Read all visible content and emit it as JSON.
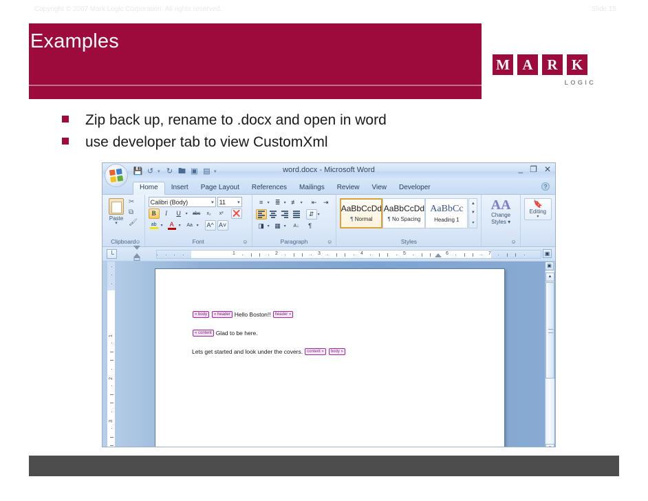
{
  "slide": {
    "title": "Examples",
    "bullets": [
      "Zip back up, rename to .docx and open in word",
      "use developer tab to view CustomXml"
    ],
    "footer": {
      "copyright": "Copyright © 2007 Mark Logic Corporation.  All rights reserved.",
      "slide_number": "Slide 15"
    },
    "logo": {
      "letters": [
        "M",
        "A",
        "R",
        "K"
      ],
      "subtitle": "LOGIC",
      "brand_color": "#9d0b3d"
    },
    "colors": {
      "banner": "#9d0b3d",
      "bullet_marker": "#9d0b3d",
      "footer_bar": "#4d4d4d",
      "body_text": "#1a1a1a"
    }
  },
  "word": {
    "titlebar": {
      "document_title": "word.docx - Microsoft Word",
      "orb": "office-orb",
      "qat": [
        {
          "name": "save-icon",
          "glyph": "■"
        },
        {
          "name": "undo-icon",
          "glyph": "↶"
        },
        {
          "name": "undo-dropdown-caret",
          "glyph": "▾"
        },
        {
          "name": "redo-icon",
          "glyph": "↷"
        },
        {
          "name": "open-icon",
          "glyph": "▱"
        },
        {
          "name": "print-preview-icon",
          "glyph": "▣"
        },
        {
          "name": "quick-print-icon",
          "glyph": "▤"
        },
        {
          "name": "customize-qat-caret",
          "glyph": "▾"
        }
      ],
      "window_controls": [
        {
          "name": "minimize-button",
          "glyph": "–"
        },
        {
          "name": "maximize-button",
          "glyph": "❐"
        },
        {
          "name": "close-button",
          "glyph": "✕"
        }
      ]
    },
    "tabs": [
      {
        "label": "Home",
        "active": true
      },
      {
        "label": "Insert",
        "active": false
      },
      {
        "label": "Page Layout",
        "active": false
      },
      {
        "label": "References",
        "active": false
      },
      {
        "label": "Mailings",
        "active": false
      },
      {
        "label": "Review",
        "active": false
      },
      {
        "label": "View",
        "active": false
      },
      {
        "label": "Developer",
        "active": false
      }
    ],
    "help_icon": "?",
    "ribbon": {
      "clipboard": {
        "label": "Clipboard",
        "paste_label": "Paste",
        "small_buttons": [
          "cut-icon",
          "copy-icon",
          "format-painter-icon"
        ]
      },
      "font": {
        "label": "Font",
        "font_name": "Calibri (Body)",
        "font_size": "11",
        "row2": [
          "B",
          "I",
          "U",
          "abc",
          "x₂",
          "x²",
          "clear-formatting"
        ],
        "row3": [
          "highlight",
          "font-color",
          "Aa",
          "A˄",
          "A˅"
        ]
      },
      "paragraph": {
        "label": "Paragraph",
        "buttons_row1": [
          "bullets",
          "numbering",
          "multilevel-list",
          "decrease-indent",
          "increase-indent"
        ],
        "buttons_row2": [
          "align-left",
          "align-center",
          "align-right",
          "justify",
          "line-spacing"
        ],
        "buttons_row3": [
          "shading",
          "borders",
          "sort",
          "show-marks"
        ]
      },
      "styles": {
        "label": "Styles",
        "gallery": [
          {
            "sample": "AaBbCcDd",
            "name": "Normal",
            "pilcrow": "¶",
            "selected": true
          },
          {
            "sample": "AaBbCcDd",
            "name": "No Spacing",
            "pilcrow": "¶",
            "selected": false
          },
          {
            "sample": "AaBbCc",
            "name": "Heading 1",
            "pilcrow": "",
            "selected": false
          }
        ]
      },
      "change_styles": {
        "label_line1": "Change",
        "label_line2": "Styles",
        "icon": "AA"
      },
      "editing": {
        "label": "Editing",
        "icon": "binoculars-icon"
      }
    },
    "ruler": {
      "tab_stop_glyph": "└",
      "h_numbers": [
        "1",
        "2",
        "3",
        "4",
        "5",
        "6",
        "7"
      ],
      "v_numbers": [
        "1",
        "2",
        "3"
      ]
    },
    "document": {
      "lines": [
        {
          "parts": [
            {
              "type": "tag",
              "text": "« body"
            },
            {
              "type": "tag",
              "text": "« header"
            },
            {
              "type": "text",
              "text": "Hello Boston!!"
            },
            {
              "type": "tag",
              "text": "header »"
            }
          ]
        },
        {
          "parts": [
            {
              "type": "tag",
              "text": "« content"
            },
            {
              "type": "text",
              "text": "Glad to be here."
            }
          ]
        },
        {
          "parts": [
            {
              "type": "text",
              "text": "Lets get started and look under the covers."
            },
            {
              "type": "tag",
              "text": "content »"
            },
            {
              "type": "tag",
              "text": "body »"
            }
          ]
        }
      ]
    }
  }
}
